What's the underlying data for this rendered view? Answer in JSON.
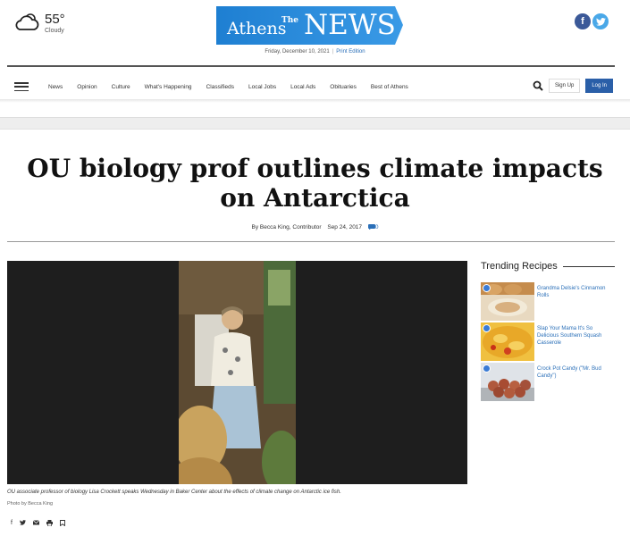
{
  "weather": {
    "temp": "55°",
    "condition": "Cloudy",
    "icon": "cloudy-sun-icon"
  },
  "logo": {
    "the": "The",
    "athens": "Athens",
    "news": "NEWS",
    "color": "#2a88d8"
  },
  "dateline": {
    "date": "Friday, December 10, 2021",
    "print_edition": "Print Edition"
  },
  "social": {
    "facebook": "f",
    "twitter": "t"
  },
  "nav": {
    "items": [
      "News",
      "Opinion",
      "Culture",
      "What's Happening",
      "Classifieds",
      "Local Jobs",
      "Local Ads",
      "Obituaries",
      "Best of Athens"
    ],
    "signup": "Sign Up",
    "login": "Log In"
  },
  "article": {
    "headline": "OU biology prof outlines climate impacts on Antarctica",
    "author": "By Becca King, Contributor",
    "date": "Sep 24, 2017",
    "comments": "0",
    "caption": "OU associate professor of biology Lisa Crockett speaks Wednesday in Baker Center about the effects of climate change on Antarctic ice fish.",
    "credit": "Photo by Becca King"
  },
  "trending": {
    "title": "Trending Recipes",
    "recipes": [
      {
        "title": "Grandma Delsie's Cinnamon Rolls"
      },
      {
        "title": "Slap Your Mama It's So Delicious Southern Squash Casserole"
      },
      {
        "title": "Crock Pot Candy (\"Mr. Bud Candy\")"
      }
    ]
  },
  "share_icons": [
    "facebook-icon",
    "twitter-icon",
    "email-icon",
    "print-icon",
    "bookmark-icon"
  ]
}
